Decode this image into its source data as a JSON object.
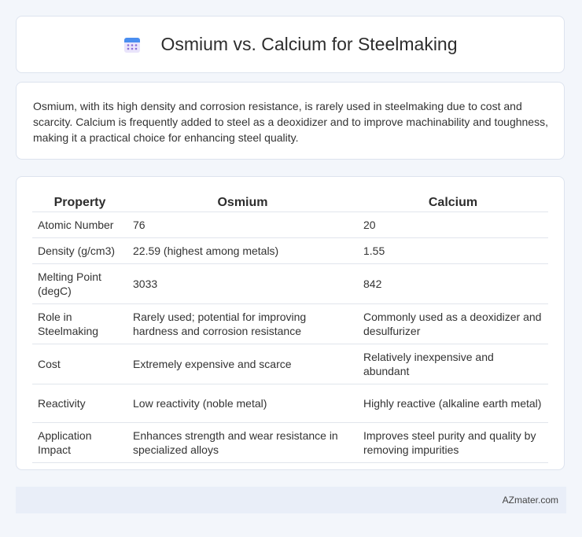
{
  "header": {
    "title": "Osmium vs. Calcium for Steelmaking",
    "icon": "calendar-icon"
  },
  "intro": {
    "text": "Osmium, with its high density and corrosion resistance, is rarely used in steelmaking due to cost and scarcity. Calcium is frequently added to steel as a deoxidizer and to improve machinability and toughness, making it a practical choice for enhancing steel quality."
  },
  "table": {
    "headers": [
      "Property",
      "Osmium",
      "Calcium"
    ],
    "rows": [
      [
        "Atomic Number",
        "76",
        "20"
      ],
      [
        "Density (g/cm3)",
        "22.59 (highest among metals)",
        "1.55"
      ],
      [
        "Melting Point (degC)",
        "3033",
        "842"
      ],
      [
        "Role in Steelmaking",
        "Rarely used; potential for improving hardness and corrosion resistance",
        "Commonly used as a deoxidizer and desulfurizer"
      ],
      [
        "Cost",
        "Extremely expensive and scarce",
        "Relatively inexpensive and abundant"
      ],
      [
        "Reactivity",
        "Low reactivity (noble metal)",
        "Highly reactive (alkaline earth metal)"
      ],
      [
        "Application Impact",
        "Enhances strength and wear resistance in specialized alloys",
        "Improves steel purity and quality by removing impurities"
      ]
    ]
  },
  "footer": {
    "brand": "AZmater.com"
  },
  "colors": {
    "icon_blue": "#4a8ef0",
    "icon_purple": "#8a6fd8",
    "footer_bg": "#e9eef8"
  }
}
